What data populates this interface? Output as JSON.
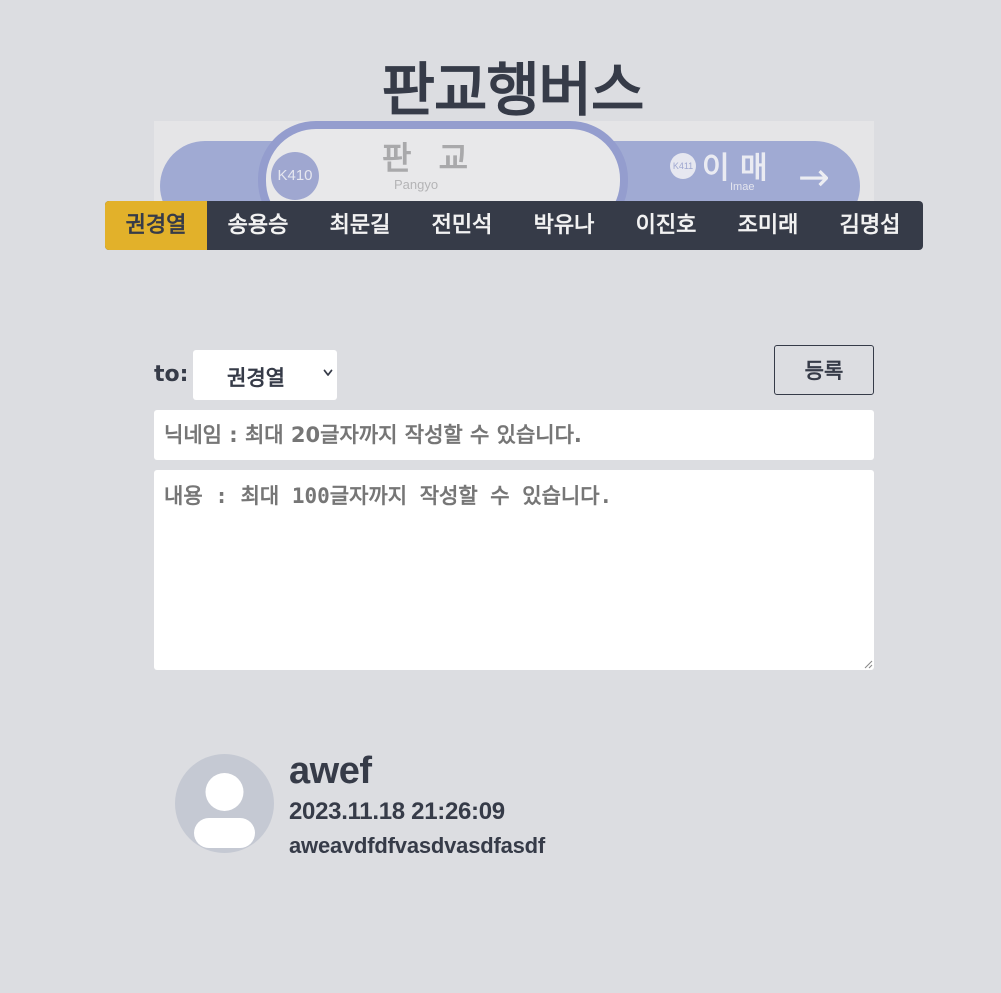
{
  "header": {
    "title": "판교행버스"
  },
  "banner": {
    "station_code": "K410",
    "station_name": "판 교",
    "station_roman": "Pangyo",
    "next_code": "K411",
    "next_name": "이 매",
    "next_roman": "Imae",
    "arrow": "→"
  },
  "nav": {
    "items": [
      {
        "label": "권경열",
        "active": true
      },
      {
        "label": "송용승",
        "active": false
      },
      {
        "label": "최문길",
        "active": false
      },
      {
        "label": "전민석",
        "active": false
      },
      {
        "label": "박유나",
        "active": false
      },
      {
        "label": "이진호",
        "active": false
      },
      {
        "label": "조미래",
        "active": false
      },
      {
        "label": "김명섭",
        "active": false
      }
    ],
    "active_color": "#e2b12a",
    "bar_color": "#363b48"
  },
  "form": {
    "to_label": "to:",
    "to_selected": "권경열",
    "submit_label": "등록",
    "nickname_placeholder": "닉네임 : 최대 20글자까지 작성할 수 있습니다.",
    "content_placeholder": "내용 : 최대 100글자까지 작성할 수 있습니다."
  },
  "comments": [
    {
      "nickname": "awef",
      "date": "2023.11.18 21:26:09",
      "body": "aweavdfdfvasdvasdfasdf"
    }
  ]
}
